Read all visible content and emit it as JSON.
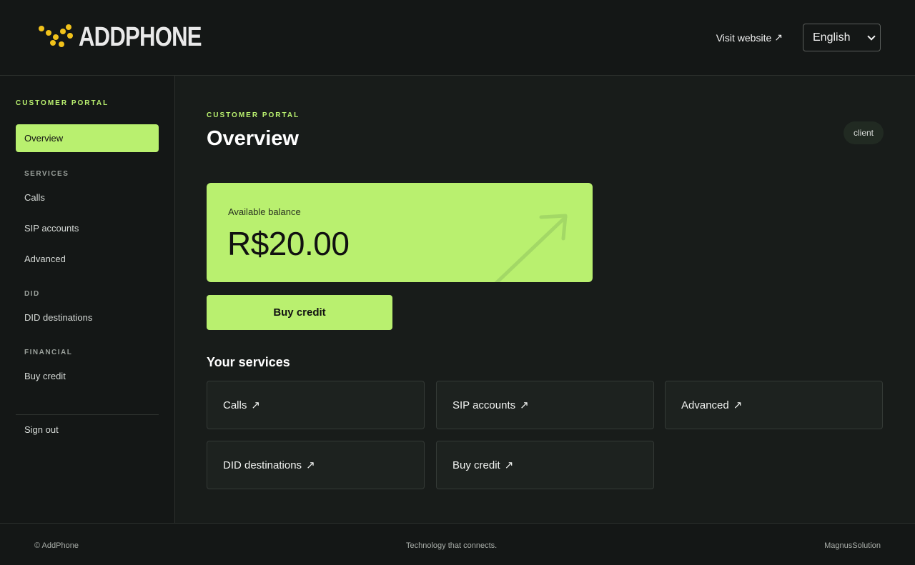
{
  "header": {
    "brand": "ADDPHONE",
    "visit_label": "Visit website",
    "arrow": "↗",
    "language": "English"
  },
  "sidebar": {
    "title": "CUSTOMER PORTAL",
    "active": "Overview",
    "sections": [
      {
        "heading": "SERVICES",
        "items": [
          "Calls",
          "SIP accounts",
          "Advanced"
        ]
      },
      {
        "heading": "DID",
        "items": [
          "DID destinations"
        ]
      },
      {
        "heading": "FINANCIAL",
        "items": [
          "Buy credit"
        ]
      }
    ],
    "signout": "Sign out"
  },
  "main": {
    "eyebrow": "CUSTOMER PORTAL",
    "title": "Overview",
    "badge": "client",
    "balance_label": "Available balance",
    "balance_value": "R$20.00",
    "buy_label": "Buy credit",
    "services_title": "Your services",
    "services": [
      "Calls",
      "SIP accounts",
      "Advanced",
      "DID destinations",
      "Buy credit"
    ]
  },
  "footer": {
    "left": "© AddPhone",
    "center": "Technology that connects.",
    "right": "MagnusSolution"
  },
  "colors": {
    "accent": "#b9f06f",
    "background": "#181c1a",
    "logo_dots": "#f1c21b"
  }
}
